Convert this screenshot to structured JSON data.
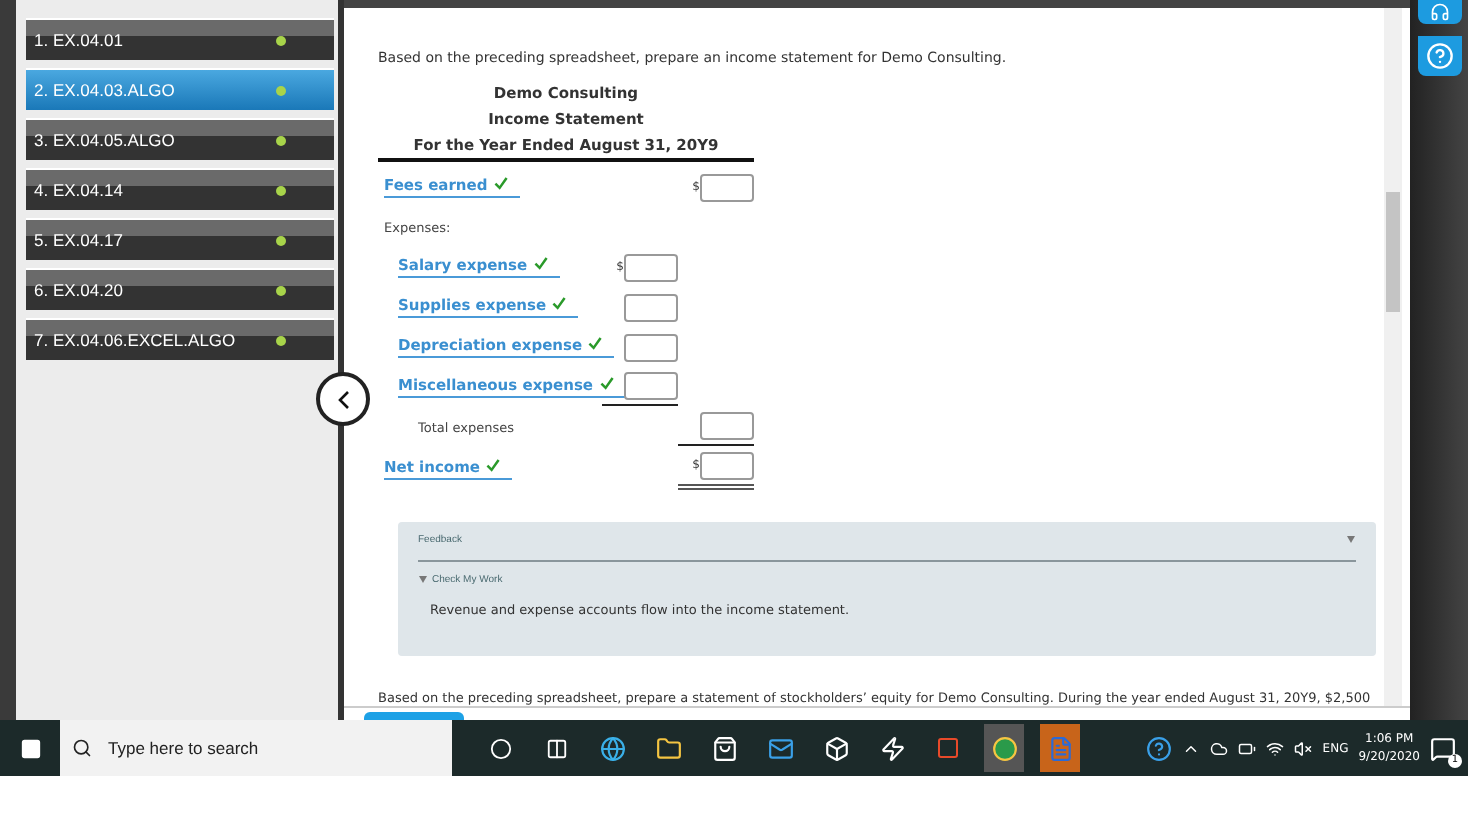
{
  "sidebar": {
    "items": [
      {
        "label": "1. EX.04.01",
        "selected": false
      },
      {
        "label": "2. EX.04.03.ALGO",
        "selected": true
      },
      {
        "label": "3. EX.04.05.ALGO",
        "selected": false
      },
      {
        "label": "4. EX.04.14",
        "selected": false
      },
      {
        "label": "5. EX.04.17",
        "selected": false
      },
      {
        "label": "6. EX.04.20",
        "selected": false
      },
      {
        "label": "7. EX.04.06.EXCEL.ALGO",
        "selected": false
      }
    ]
  },
  "problem": {
    "prompt": "Based on the preceding spreadsheet, prepare an income statement for Demo Consulting.",
    "company": "Demo Consulting",
    "statement": "Income Statement",
    "period": "For the Year Ended August 31, 20Y9",
    "rows": [
      {
        "kind": "account",
        "label": "Fees earned",
        "correct": true,
        "currency": "$"
      },
      {
        "kind": "heading",
        "label": "Expenses:",
        "children": [
          {
            "label": "Salary expense",
            "correct": true,
            "currency": "$"
          },
          {
            "label": "Supplies expense",
            "correct": true
          },
          {
            "label": "Depreciation expense",
            "correct": true
          },
          {
            "label": "Miscellaneous expense",
            "correct": true
          }
        ]
      },
      {
        "kind": "total",
        "label": "Total expenses"
      },
      {
        "kind": "account",
        "label": "Net income",
        "correct": true,
        "currency": "$"
      }
    ]
  },
  "feedback": {
    "title": "Feedback",
    "section": "Check My Work",
    "expanded": true,
    "message": "Revenue and expense accounts flow into the income statement."
  },
  "next_prompt": "Based on the preceding spreadsheet, prepare a statement of stockholders’ equity for Demo Consulting. During the year ended August 31, 20Y9, $2,500",
  "taskbar": {
    "search_placeholder": "Type here to search",
    "language": "ENG",
    "time": "1:06 PM",
    "date": "9/20/2020",
    "notification_count": "1"
  }
}
